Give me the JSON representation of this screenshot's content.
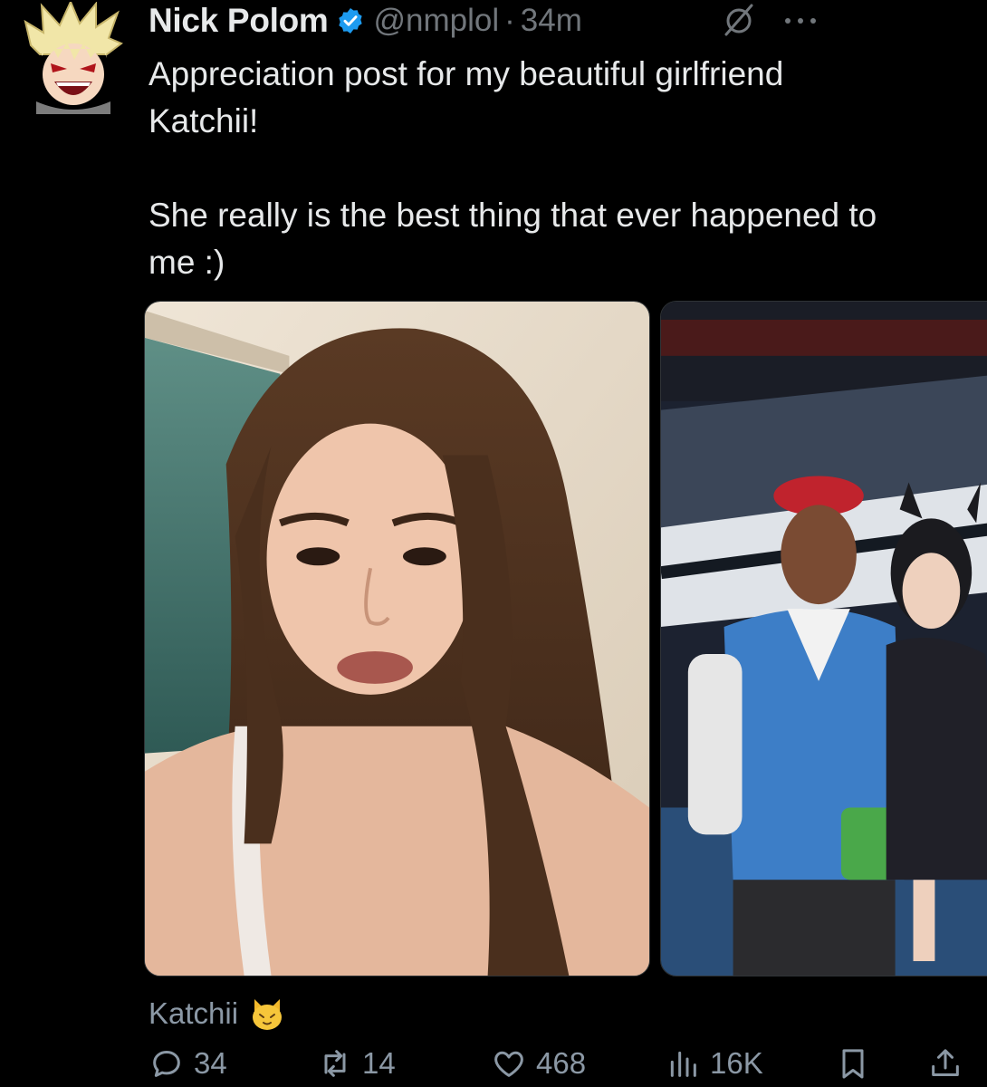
{
  "author": {
    "name": "Nick Polom",
    "handle": "@nmplol",
    "separator": "·",
    "time": "34m"
  },
  "tweet": {
    "text": "Appreciation post for my beautiful girlfriend\nKatchii!\n\nShe really is the best thing that ever happened to\nme :)"
  },
  "media": [
    {
      "description": "selfie-photo"
    },
    {
      "description": "cosplay-photo"
    }
  ],
  "tag": {
    "label": "Katchii",
    "icon": "cat-face-icon"
  },
  "actions": {
    "replies": "34",
    "retweets": "14",
    "likes": "468",
    "views": "16K"
  },
  "colors": {
    "background": "#000000",
    "text": "#e7e9ea",
    "muted": "#71767b",
    "verified": "#1d9bf0"
  }
}
